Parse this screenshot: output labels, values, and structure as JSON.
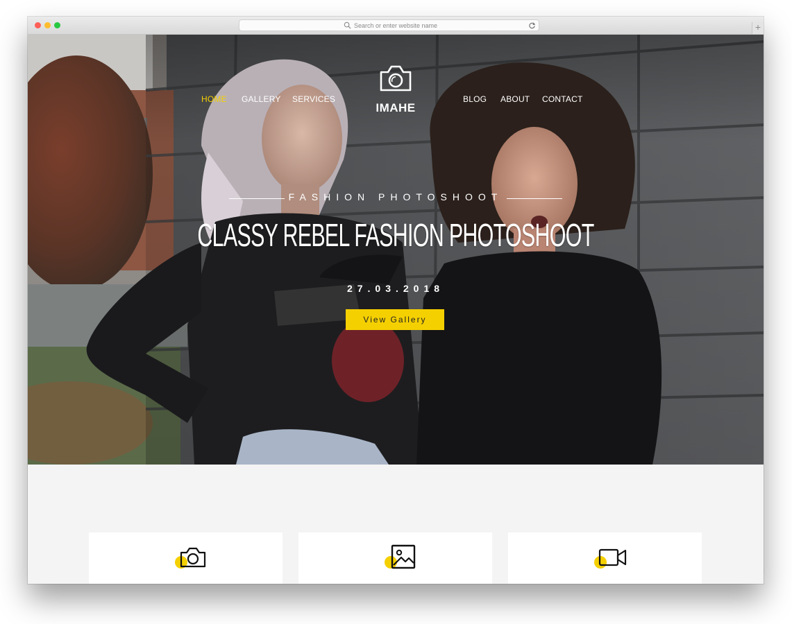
{
  "browser": {
    "address_placeholder": "Search or enter website name",
    "new_tab_label": "+"
  },
  "nav": {
    "left": [
      "HOME",
      "GALLERY",
      "SERVICES"
    ],
    "right": [
      "BLOG",
      "ABOUT",
      "CONTACT"
    ],
    "active": "HOME"
  },
  "brand": {
    "name": "IMAHE",
    "icon": "camera-icon"
  },
  "hero": {
    "eyebrow": "FASHION PHOTOSHOOT",
    "title": "CLASSY REBEL FASHION PHOTOSHOOT",
    "date": "27.03.2018",
    "cta_label": "View Gallery"
  },
  "features": {
    "icons": [
      "camera-icon",
      "image-icon",
      "video-camera-icon"
    ]
  },
  "colors": {
    "accent": "#f5d000",
    "page_background": "#f4f4f4",
    "card_background": "#ffffff"
  }
}
